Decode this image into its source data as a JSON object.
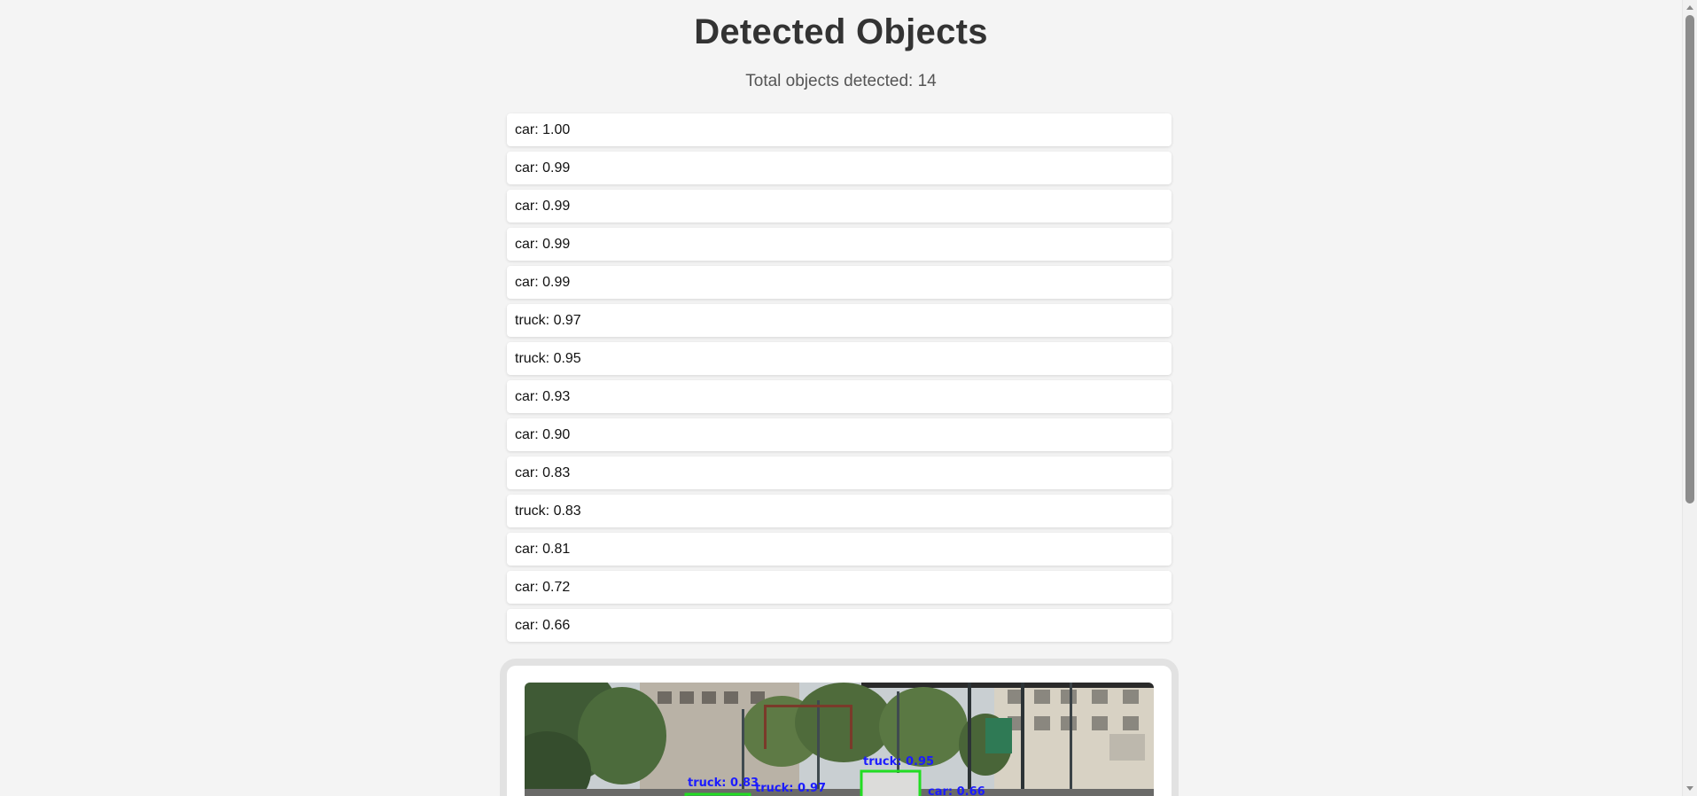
{
  "page": {
    "title": "Detected Objects",
    "summary": "Total objects detected: 14"
  },
  "detections": [
    "car: 1.00",
    "car: 0.99",
    "car: 0.99",
    "car: 0.99",
    "car: 0.99",
    "truck: 0.97",
    "truck: 0.95",
    "car: 0.93",
    "car: 0.90",
    "car: 0.83",
    "truck: 0.83",
    "car: 0.81",
    "car: 0.72",
    "car: 0.66"
  ],
  "image_overlay_labels": {
    "label_a": "truck: 0.95",
    "label_b": "truck: 0.83",
    "label_c": "truck: 0.97",
    "label_d": "car: 0.66"
  },
  "colors": {
    "box": "#22dd22",
    "label": "#1c1cff"
  }
}
